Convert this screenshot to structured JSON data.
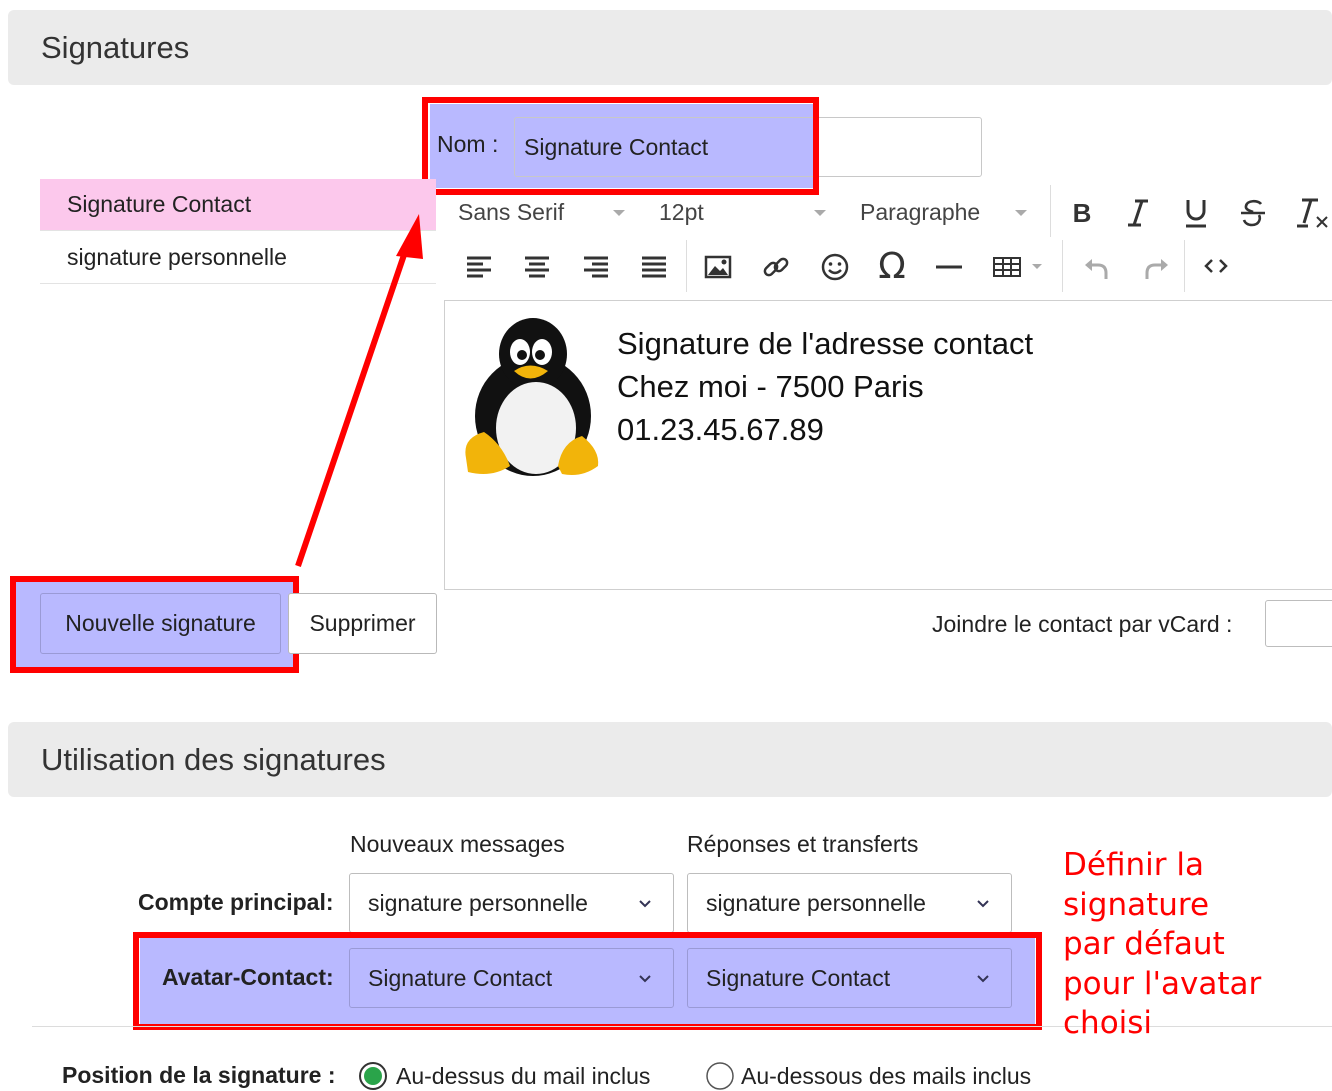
{
  "sections": {
    "signatures_title": "Signatures",
    "usage_title": "Utilisation des signatures"
  },
  "name_field": {
    "label": "Nom :",
    "value": "Signature Contact"
  },
  "signature_list": [
    {
      "label": "Signature Contact",
      "selected": true
    },
    {
      "label": "signature personnelle",
      "selected": false
    }
  ],
  "buttons": {
    "new": "Nouvelle signature",
    "delete": "Supprimer"
  },
  "toolbar": {
    "font_family": "Sans Serif",
    "font_size": "12pt",
    "block_format": "Paragraphe",
    "icons": [
      "bold-icon",
      "italic-icon",
      "underline-icon",
      "strikethrough-icon",
      "clear-format-icon",
      "align-left-icon",
      "align-center-icon",
      "align-right-icon",
      "align-justify-icon",
      "image-icon",
      "link-icon",
      "emoticon-icon",
      "special-char-icon",
      "horizontal-rule-icon",
      "table-icon",
      "undo-icon",
      "redo-icon",
      "source-code-icon"
    ]
  },
  "editor": {
    "lines": [
      "Signature de l'adresse contact",
      "Chez moi - 7500 Paris",
      "01.23.45.67.89"
    ]
  },
  "vcard": {
    "label": "Joindre le contact par vCard :"
  },
  "usage": {
    "col_new": "Nouveaux messages",
    "col_reply": "Réponses et transferts",
    "rows": [
      {
        "label": "Compte principal:",
        "new_value": "signature personnelle",
        "reply_value": "signature personnelle"
      },
      {
        "label": "Avatar-Contact:",
        "new_value": "Signature Contact",
        "reply_value": "Signature Contact"
      }
    ],
    "position_label": "Position de la signature :",
    "position_options": [
      "Au-dessus du mail inclus",
      "Au-dessous des mails inclus"
    ],
    "position_selected": 0
  },
  "annotation": {
    "lines": [
      "Définir la",
      "signature",
      "par défaut",
      "pour l'avatar",
      "choisi"
    ],
    "color": "#ff0000"
  },
  "colors": {
    "highlight_pink": "#fcc8ec",
    "highlight_blue": "#b9b9ff",
    "annotation_red": "#ff0000",
    "radio_green": "#2aa44a"
  }
}
